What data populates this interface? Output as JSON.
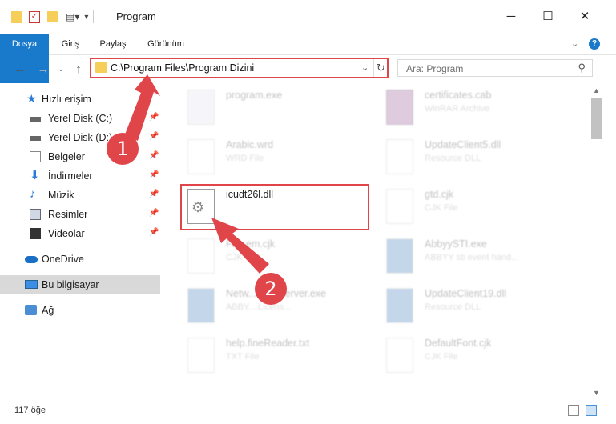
{
  "window": {
    "title": "Program",
    "minimize": "─",
    "maximize": "☐",
    "close": "✕"
  },
  "ribbon": {
    "tabs": [
      "Dosya",
      "Giriş",
      "Paylaş",
      "Görünüm"
    ],
    "help": "?"
  },
  "address": {
    "path": "C:\\Program Files\\Program Dizini",
    "search_placeholder": "Ara: Program"
  },
  "sidebar": {
    "items": [
      {
        "label": "Hızlı erişim",
        "icon": "star-icon"
      },
      {
        "label": "Yerel Disk (C:)",
        "icon": "drive-icon",
        "pinned": true
      },
      {
        "label": "Yerel Disk (D:)",
        "icon": "drive-icon",
        "pinned": true
      },
      {
        "label": "Belgeler",
        "icon": "documents-icon",
        "pinned": true
      },
      {
        "label": "İndirmeler",
        "icon": "download-icon",
        "pinned": true
      },
      {
        "label": "Müzik",
        "icon": "music-icon",
        "pinned": true
      },
      {
        "label": "Resimler",
        "icon": "pictures-icon",
        "pinned": true
      },
      {
        "label": "Videolar",
        "icon": "videos-icon",
        "pinned": true
      },
      {
        "label": "OneDrive",
        "icon": "cloud-icon"
      },
      {
        "label": "Bu bilgisayar",
        "icon": "computer-icon"
      },
      {
        "label": "Ağ",
        "icon": "network-icon"
      }
    ]
  },
  "files": [
    {
      "name": "program.exe",
      "type": "",
      "icon": "exe-icon"
    },
    {
      "name": "certificates.cab",
      "type": "WinRAR Archive",
      "icon": "archive-icon"
    },
    {
      "name": "Arabic.wrd",
      "type": "WRD File",
      "icon": "doc-icon"
    },
    {
      "name": "UpdateClient5.dll",
      "type": "Resource DLL",
      "icon": "dll-icon"
    },
    {
      "name": "icudt26l.dll",
      "type": "",
      "icon": "dll-icon"
    },
    {
      "name": "gtd.cjk",
      "type": "CJK File",
      "icon": "doc-icon"
    },
    {
      "name": "Fa...em.cjk",
      "type": "CJK File",
      "icon": "doc-icon"
    },
    {
      "name": "AbbyySTI.exe",
      "type": "ABBYY sti event hand...",
      "icon": "exe-icon"
    },
    {
      "name": "Netw...enseServer.exe",
      "type": "ABBY... Licens...",
      "icon": "exe-icon"
    },
    {
      "name": "UpdateClient19.dll",
      "type": "Resource DLL",
      "icon": "dll-icon"
    },
    {
      "name": "help.fineReader.txt",
      "type": "TXT File",
      "icon": "doc-icon"
    },
    {
      "name": "DefaultFont.cjk",
      "type": "CJK File",
      "icon": "doc-icon"
    }
  ],
  "annotations": {
    "step1": "1",
    "step2": "2"
  },
  "status": {
    "count": "117 öğe"
  },
  "colors": {
    "accent": "#1979ca",
    "highlight": "#e0454a"
  }
}
